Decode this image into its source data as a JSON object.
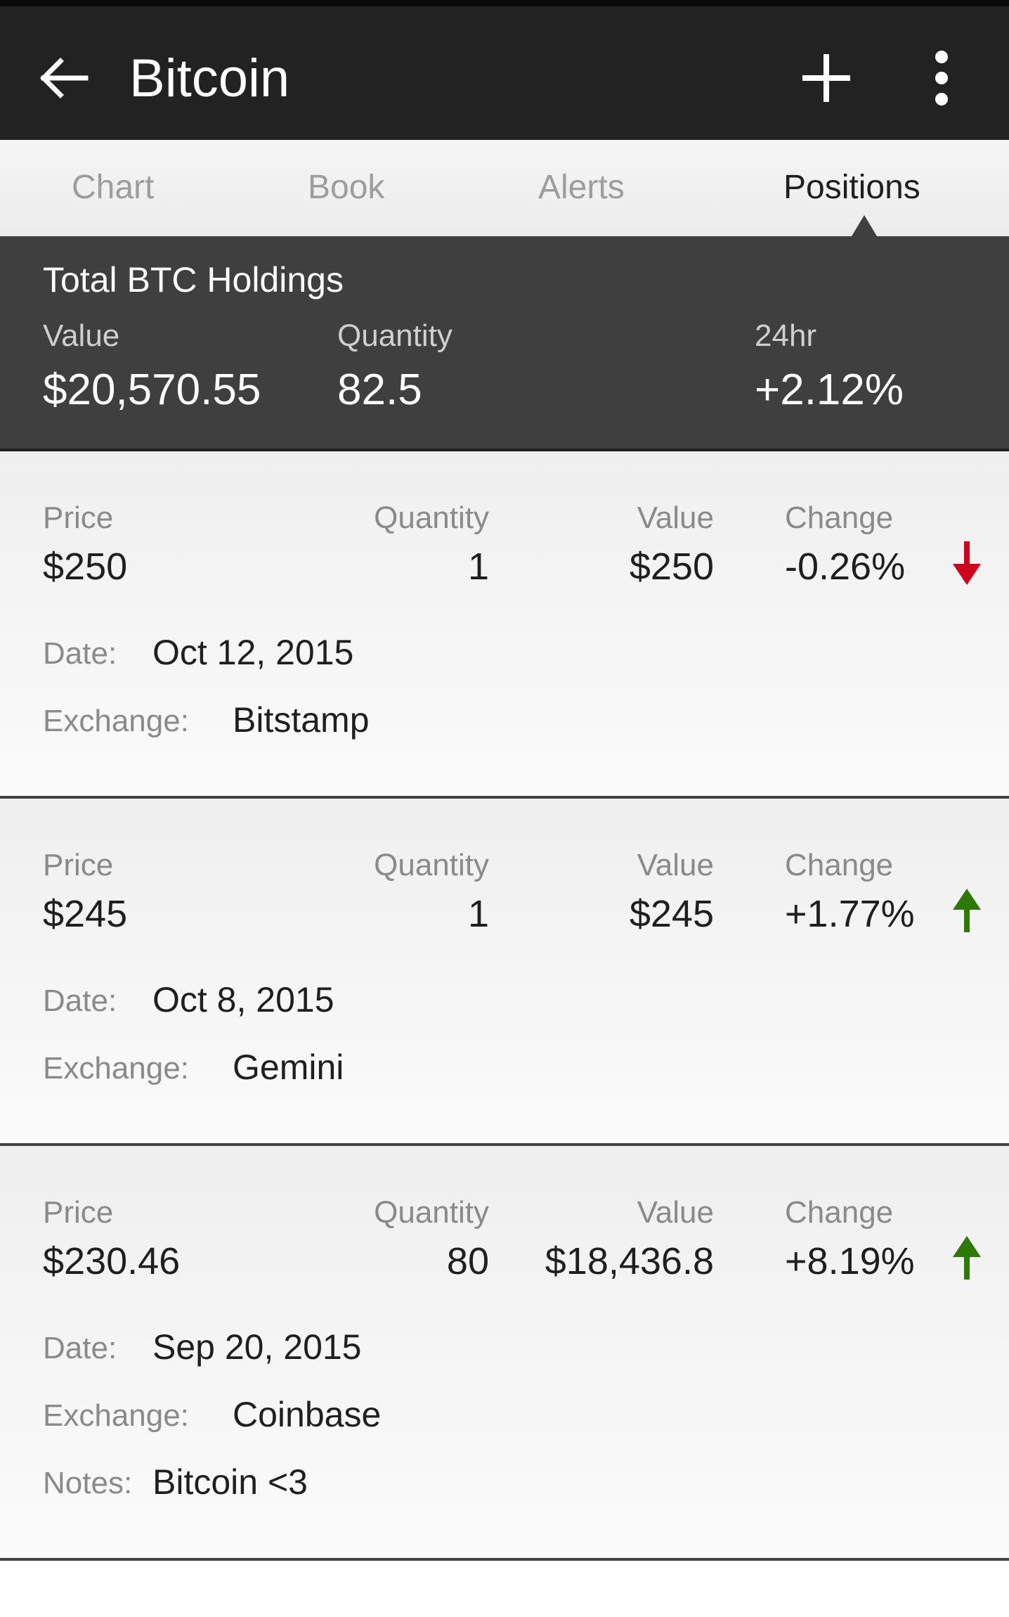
{
  "appbar": {
    "title": "Bitcoin",
    "back_icon": "arrow-left-icon",
    "add_icon": "plus-icon",
    "more_icon": "more-vertical-icon"
  },
  "tabs": [
    {
      "label": "Chart",
      "active": false
    },
    {
      "label": "Book",
      "active": false
    },
    {
      "label": "Alerts",
      "active": false
    },
    {
      "label": "Positions",
      "active": true
    }
  ],
  "summary": {
    "title": "Total BTC Holdings",
    "value_label": "Value",
    "value": "$20,570.55",
    "quantity_label": "Quantity",
    "quantity": "82.5",
    "change_label": "24hr",
    "change": "+2.12%"
  },
  "labels": {
    "price": "Price",
    "quantity": "Quantity",
    "value": "Value",
    "change": "Change",
    "date": "Date:",
    "exchange": "Exchange:",
    "notes": "Notes:"
  },
  "positions": [
    {
      "price": "$250",
      "quantity": "1",
      "value": "$250",
      "change": "-0.26%",
      "direction": "down",
      "date": "Oct 12, 2015",
      "exchange": "Bitstamp"
    },
    {
      "price": "$245",
      "quantity": "1",
      "value": "$245",
      "change": "+1.77%",
      "direction": "up",
      "date": "Oct 8, 2015",
      "exchange": "Gemini"
    },
    {
      "price": "$230.46",
      "quantity": "80",
      "value": "$18,436.8",
      "change": "+8.19%",
      "direction": "up",
      "date": "Sep 20, 2015",
      "exchange": "Coinbase",
      "notes": "Bitcoin <3"
    }
  ],
  "colors": {
    "appbar": "#222222",
    "summary": "#3f3f3f",
    "down": "#d0021b",
    "up": "#2d7a00"
  }
}
